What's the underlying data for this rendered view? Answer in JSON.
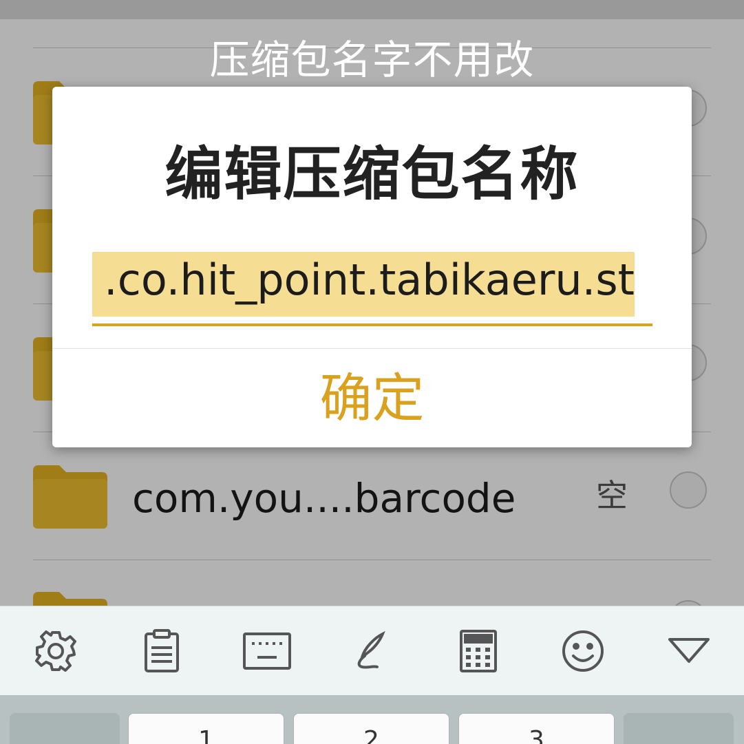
{
  "hint_text": "压缩包名字不用改",
  "dialog": {
    "title": "编辑压缩包名称",
    "input_value": ".co.hit_point.tabikaeru.st",
    "confirm_label": "确定"
  },
  "file_list": {
    "visible_row": {
      "name": "com.you....barcode",
      "size": "空"
    }
  },
  "keyboard": {
    "toolbar_icons": [
      "gear-icon",
      "clipboard-icon",
      "keyboard-icon",
      "handwriting-icon",
      "calculator-icon",
      "emoji-icon",
      "collapse-icon"
    ],
    "keys": [
      "1",
      "2",
      "3"
    ]
  },
  "colors": {
    "accent": "#d9a11d",
    "selection": "#f6dd94",
    "folder": "#e6b422"
  }
}
